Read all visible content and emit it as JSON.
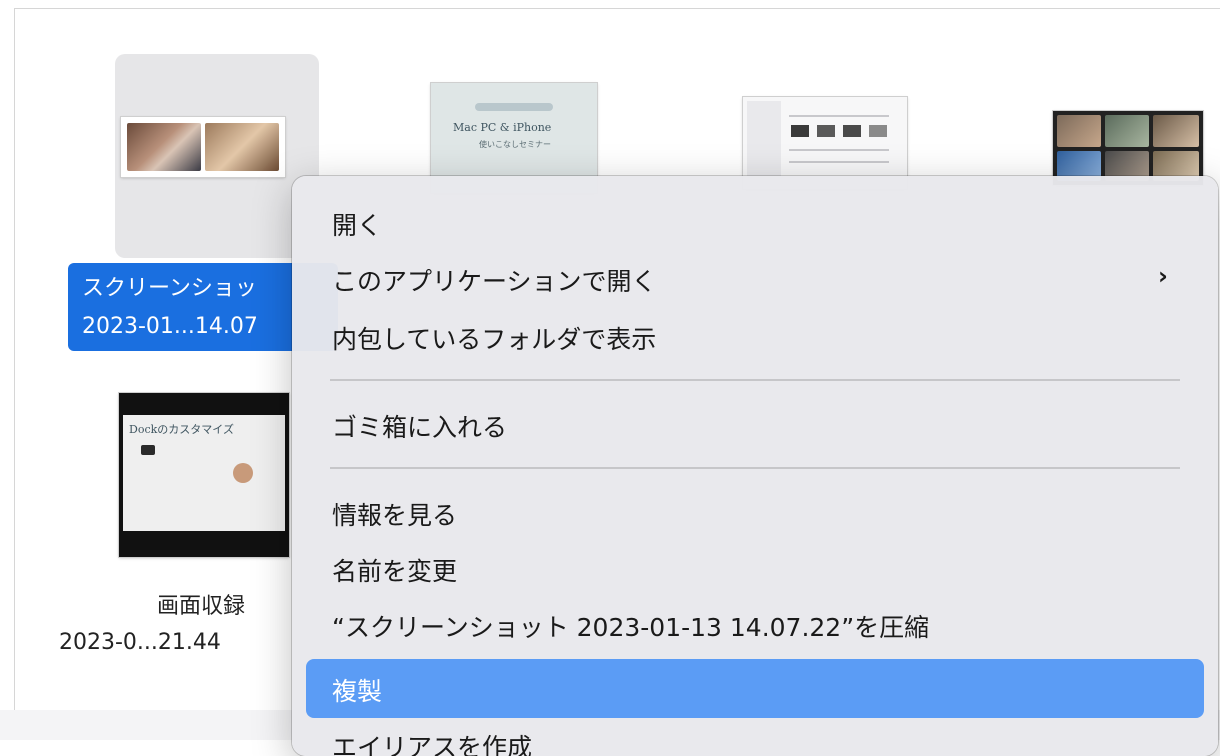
{
  "files": [
    {
      "name_line1": "スクリーンショッ",
      "name_line2": "2023-01...14.07",
      "selected": true,
      "thumb_icon": "video-call-screenshot-icon"
    },
    {
      "name_line1": "",
      "name_line2": "",
      "selected": false,
      "thumb_icon": "seminar-slide-thumbnail-icon",
      "slide_title": "Mac PC & iPhone",
      "slide_subtitle": "使いこなしセミナー"
    },
    {
      "name_line1": "",
      "name_line2": "",
      "selected": false,
      "thumb_icon": "finder-window-thumbnail-icon"
    },
    {
      "name_line1": "",
      "name_line2": "",
      "selected": false,
      "thumb_icon": "video-call-grid-thumbnail-icon"
    },
    {
      "name_line1": "画面収録",
      "name_line2": "2023-0...21.44",
      "selected": false,
      "thumb_icon": "dock-customize-video-thumbnail-icon",
      "slide_title": "Dockのカスタマイズ"
    }
  ],
  "context_menu": {
    "items": [
      {
        "label": "開く",
        "has_submenu": false
      },
      {
        "label": "このアプリケーションで開く",
        "has_submenu": true
      },
      {
        "label": "内包しているフォルダで表示",
        "has_submenu": false
      },
      {
        "label": "ゴミ箱に入れる",
        "has_submenu": false
      },
      {
        "label": "情報を見る",
        "has_submenu": false
      },
      {
        "label": "名前を変更",
        "has_submenu": false
      },
      {
        "label": "“スクリーンショット 2023-01-13 14.07.22”を圧縮",
        "has_submenu": false
      },
      {
        "label": "複製",
        "has_submenu": false,
        "highlighted": true
      },
      {
        "label": "エイリアスを作成",
        "has_submenu": false
      }
    ],
    "submenu_glyph": "›"
  },
  "colors": {
    "selection_blue": "#1a6fe0",
    "menu_highlight": "#5b9cf5",
    "menu_background": "#e8e8ec"
  }
}
